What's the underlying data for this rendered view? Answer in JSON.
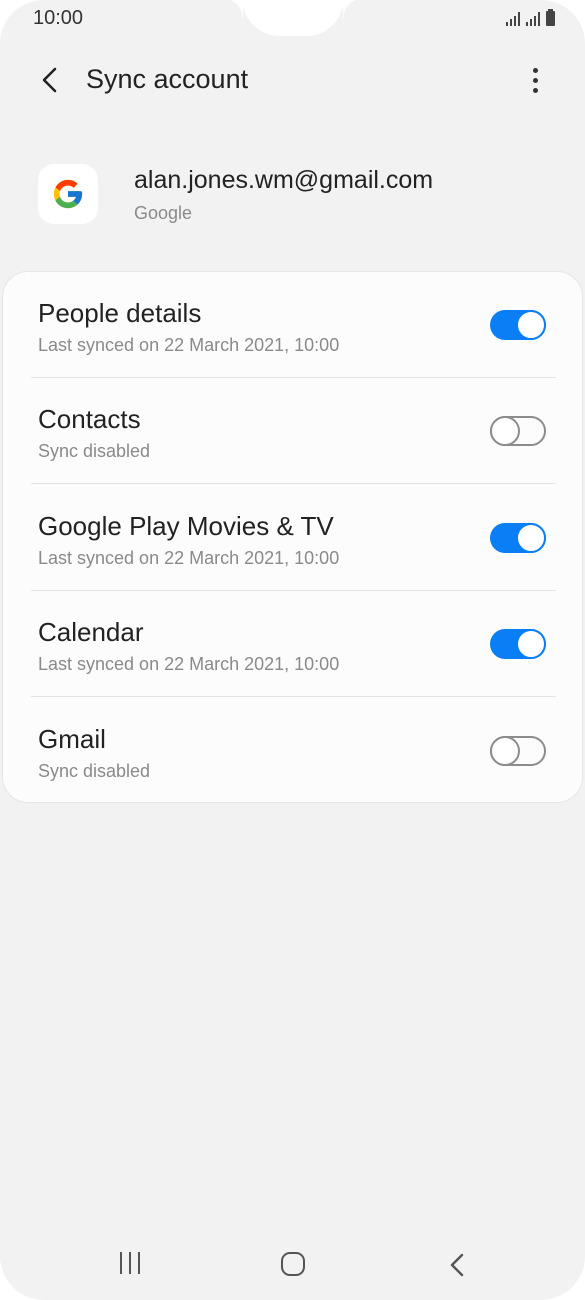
{
  "status_bar": {
    "time": "10:00",
    "icons": [
      "signal-icon",
      "signal-icon",
      "battery-icon"
    ]
  },
  "app_bar": {
    "title": "Sync account",
    "back_icon": "chevron-left-icon",
    "more_icon": "more-vert-icon"
  },
  "account": {
    "icon": "google-logo-icon",
    "email": "alan.jones.wm@gmail.com",
    "type": "Google"
  },
  "sync_items": [
    {
      "title": "People details",
      "subtitle": "Last synced on 22 March 2021, 10:00",
      "enabled": true
    },
    {
      "title": "Contacts",
      "subtitle": "Sync disabled",
      "enabled": false
    },
    {
      "title": "Google Play Movies & TV",
      "subtitle": "Last synced on 22 March 2021, 10:00",
      "enabled": true
    },
    {
      "title": "Calendar",
      "subtitle": "Last synced on 22 March 2021, 10:00",
      "enabled": true
    },
    {
      "title": "Gmail",
      "subtitle": "Sync disabled",
      "enabled": false
    }
  ],
  "nav_bar": {
    "icons": [
      "recent-apps-icon",
      "home-icon",
      "back-icon"
    ]
  },
  "colors": {
    "accent": "#0a7ff5",
    "background": "#f2f2f2",
    "card": "#fcfcfc",
    "text_primary": "#222222",
    "text_secondary": "#8a8a8a"
  }
}
